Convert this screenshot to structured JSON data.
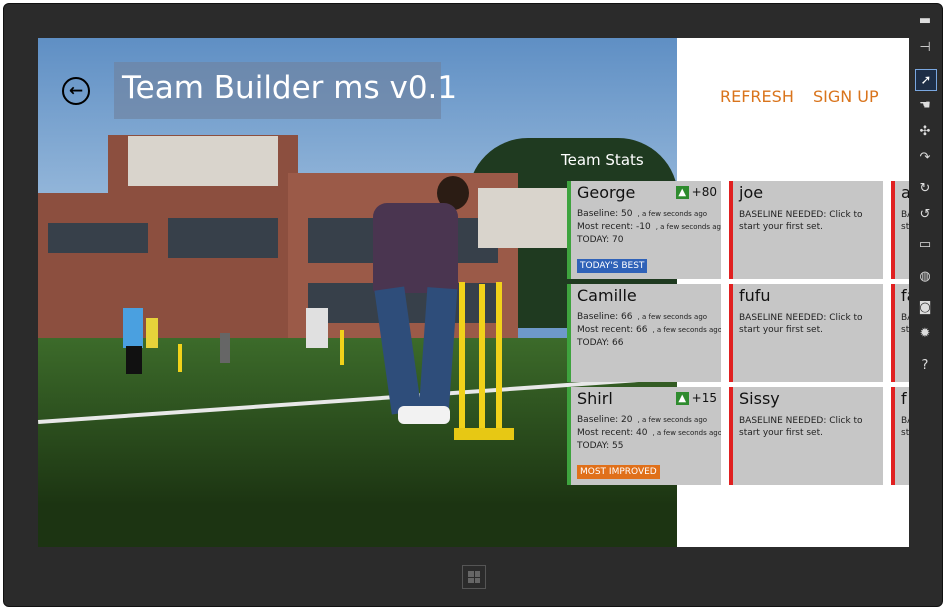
{
  "app": {
    "title": "Team Builder ms v0.1"
  },
  "header": {
    "refresh_label": "REFRESH",
    "signup_label": "SIGN UP"
  },
  "section": {
    "title": "Team Stats"
  },
  "players": [
    {
      "name": "George",
      "delta": "+80",
      "baseline": "Baseline: 50",
      "baseline_time": ", a few seconds ago",
      "recent": "Most recent: -10",
      "recent_time": ", a few seconds ago",
      "today": "TODAY:  70",
      "badge": "TODAY'S BEST"
    },
    {
      "name": "Camille",
      "baseline": "Baseline: 66",
      "baseline_time": ", a few seconds ago",
      "recent": "Most recent: 66",
      "recent_time": ", a few seconds ago",
      "today": "TODAY:  66"
    },
    {
      "name": "Shirl",
      "delta": "+15",
      "baseline": "Baseline: 20",
      "baseline_time": ", a few seconds ago",
      "recent": "Most recent: 40",
      "recent_time": ", a few seconds ago",
      "today": "TODAY:  55",
      "badge": "MOST IMPROVED"
    },
    {
      "name": "joe",
      "message": "BASELINE NEEDED: Click to start your first set."
    },
    {
      "name": "fufu",
      "message": "BASELINE NEEDED: Click to start your first set."
    },
    {
      "name": "Sissy",
      "message": "BASELINE NEEDED: Click to start your first set."
    },
    {
      "name": "a",
      "message": "BASELINE NEEDED: Click to start your first set."
    },
    {
      "name": "fa",
      "message": "BASELINE NEEDED: Click to start your first set."
    },
    {
      "name": "f",
      "message": "BASELINE NEEDED: Click to start your first set."
    }
  ],
  "charms": [
    {
      "icon": "minimize-icon",
      "glyph": "▬"
    },
    {
      "icon": "pin-icon",
      "glyph": "⊣"
    },
    {
      "icon": "pointer-icon",
      "glyph": "➚"
    },
    {
      "icon": "hand-icon",
      "glyph": "☚"
    },
    {
      "icon": "pinch-icon",
      "glyph": "✣"
    },
    {
      "icon": "rotate-icon",
      "glyph": "↷"
    },
    {
      "icon": "rotate-cw-icon",
      "glyph": "↻"
    },
    {
      "icon": "rotate-ccw-icon",
      "glyph": "↺"
    },
    {
      "icon": "monitor-icon",
      "glyph": "▭"
    },
    {
      "icon": "globe-icon",
      "glyph": "◍"
    },
    {
      "icon": "camera-icon",
      "glyph": "◙"
    },
    {
      "icon": "gear-icon",
      "glyph": "✹"
    },
    {
      "icon": "help-icon",
      "glyph": "?"
    }
  ],
  "colors": {
    "accent": "#d9741c",
    "tile_bg": "#c6c6c6",
    "good": "#3ea33e",
    "needs_baseline": "#e02020",
    "badge_best": "#2f62b8",
    "badge_improved": "#e0701a"
  }
}
